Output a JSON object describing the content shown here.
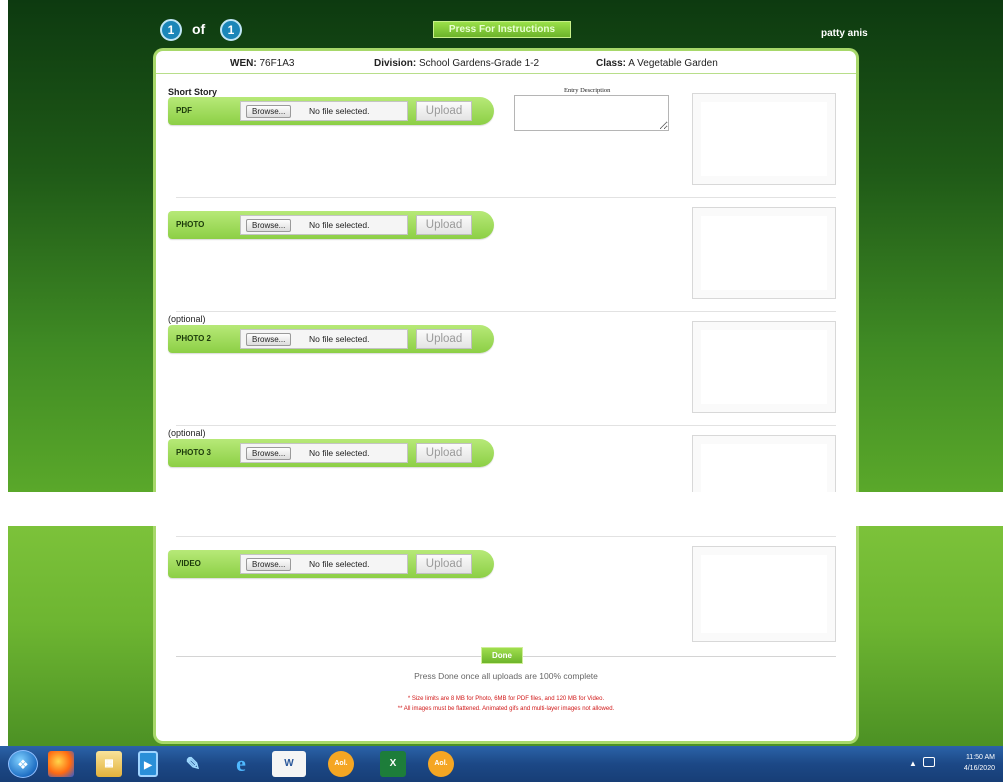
{
  "header": {
    "page_current": "1",
    "page_of": "of",
    "page_total": "1",
    "instructions_button": "Press For Instructions",
    "user_name": "patty anis"
  },
  "entry_info": {
    "wen_label": "WEN:",
    "wen_value": "76F1A3",
    "division_label": "Division:",
    "division_value": "School Gardens-Grade 1-2",
    "class_label": "Class:",
    "class_value": "A Vegetable Garden"
  },
  "section_title": "Short Story",
  "entry_description_label": "Entry Description",
  "optional_label": "(optional)",
  "uploads": [
    {
      "type": "PDF",
      "browse": "Browse...",
      "status": "No file selected.",
      "upload": "Upload"
    },
    {
      "type": "PHOTO",
      "browse": "Browse...",
      "status": "No file selected.",
      "upload": "Upload"
    },
    {
      "type": "PHOTO 2",
      "browse": "Browse...",
      "status": "No file selected.",
      "upload": "Upload"
    },
    {
      "type": "PHOTO 3",
      "browse": "Browse...",
      "status": "No file selected.",
      "upload": "Upload"
    },
    {
      "type": "VIDEO",
      "browse": "Browse...",
      "status": "No file selected.",
      "upload": "Upload"
    }
  ],
  "footer": {
    "done_button": "Done",
    "done_note": "Press Done once all uploads are 100% complete",
    "size_note": "* Size limits are 8 MB for Photo, 6MB for PDF files, and 120 MB for Video.",
    "flatten_note": "** All images must be flattened.  Animated gifs and multi-layer images not allowed."
  },
  "taskbar": {
    "time": "11:50 AM",
    "date": "4/16/2020",
    "icons": [
      "windows-start-icon",
      "firefox-icon",
      "file-explorer-icon",
      "media-player-icon",
      "notes-icon",
      "internet-explorer-icon",
      "word-icon",
      "aol-icon",
      "excel-icon",
      "aol-icon-2"
    ],
    "word_label": "W",
    "excel_label": "X",
    "aol_label": "Aol."
  },
  "colors": {
    "accent_green": "#8ccf45",
    "header_blue": "#1a86b8",
    "warning_red": "#d01818"
  }
}
